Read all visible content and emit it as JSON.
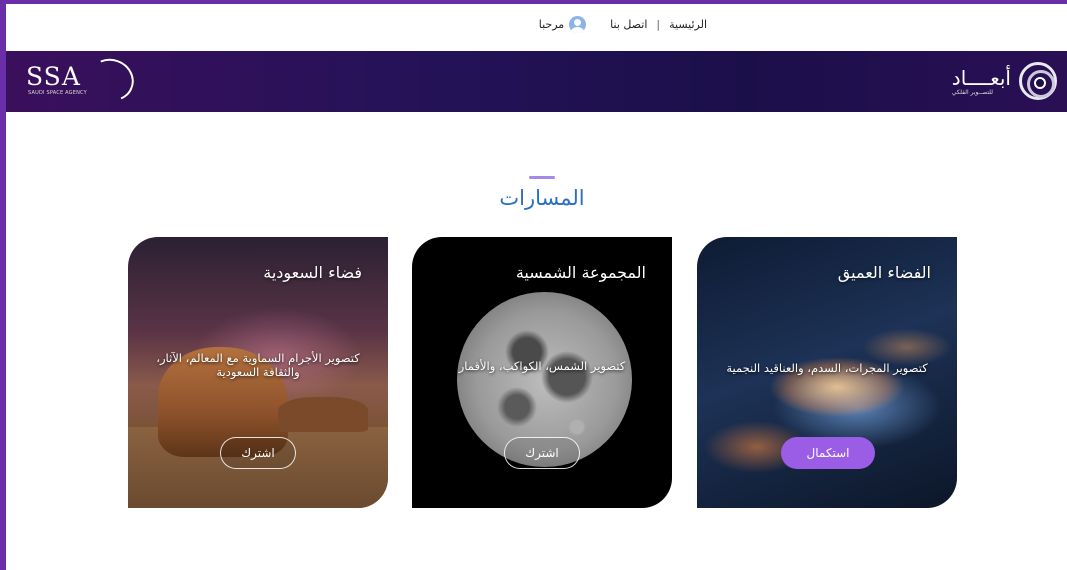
{
  "topbar": {
    "home_label": "الرئيسية",
    "separator": "|",
    "contact_label": "اتصل بنا",
    "greeting": "مرحبا"
  },
  "header": {
    "ssa_logo_text": "SSA",
    "ssa_logo_sub": "SAUDI SPACE AGENCY",
    "ab_logo_name": "أبعــــاد",
    "ab_logo_tag": "للتصــوير الفلكي"
  },
  "section": {
    "title": "المسارات"
  },
  "cards": [
    {
      "title": "الفضاء العميق",
      "description": "كتصوير المجرات، السدم، والعناقيد النجمية",
      "button": "استكمال"
    },
    {
      "title": "المجموعة الشمسية",
      "description": "كتصوير الشمس، الكواكب، والأقمار",
      "button": "اشترك"
    },
    {
      "title": "فضاء السعودية",
      "description": "كتصوير الأجرام السماوية مع المعالم، الآثار، والثقافة السعودية",
      "button": "اشترك"
    }
  ],
  "colors": {
    "frame": "#6a2fa8",
    "title_blue": "#2b6fc0",
    "accent_purple": "#9b5de5"
  }
}
